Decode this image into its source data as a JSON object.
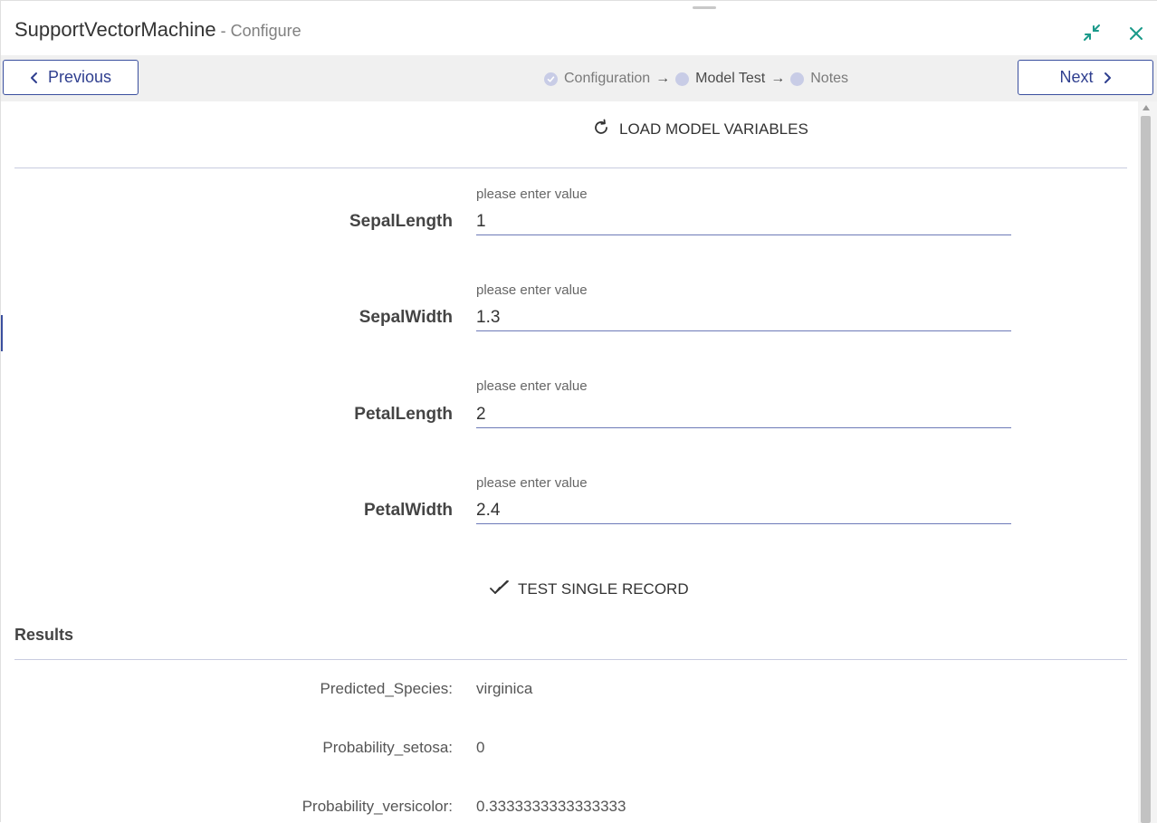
{
  "window": {
    "title": "SupportVectorMachine",
    "subtitle": " - Configure"
  },
  "nav": {
    "previous_label": "Previous",
    "next_label": "Next",
    "steps": [
      {
        "label": "Configuration",
        "state": "completed"
      },
      {
        "label": "Model Test",
        "state": "active"
      },
      {
        "label": "Notes",
        "state": "pending"
      }
    ],
    "arrow": "→"
  },
  "actions": {
    "load_label": "LOAD MODEL VARIABLES",
    "test_label": "TEST SINGLE RECORD"
  },
  "fields": [
    {
      "label": "SepalLength",
      "hint": "please enter value",
      "value": "1"
    },
    {
      "label": "SepalWidth",
      "hint": "please enter value",
      "value": "1.3"
    },
    {
      "label": "PetalLength",
      "hint": "please enter value",
      "value": "2"
    },
    {
      "label": "PetalWidth",
      "hint": "please enter value",
      "value": "2.4"
    }
  ],
  "results": {
    "title": "Results",
    "rows": [
      {
        "label": "Predicted_Species:",
        "value": "virginica"
      },
      {
        "label": "Probability_setosa:",
        "value": "0"
      },
      {
        "label": "Probability_versicolor:",
        "value": "0.3333333333333333"
      }
    ]
  },
  "colors": {
    "accent": "#3a4f9e",
    "teal_icon": "#1a9a8a",
    "nav_bg": "#f0f0f0",
    "step_dot": "#c8cce6"
  },
  "icons": {
    "minimize": "collapse-arrows-icon",
    "close": "close-icon",
    "previous": "chevron-left-icon",
    "next": "chevron-right-icon",
    "load": "refresh-icon",
    "test": "double-check-icon",
    "step_done": "check-circle-icon"
  }
}
